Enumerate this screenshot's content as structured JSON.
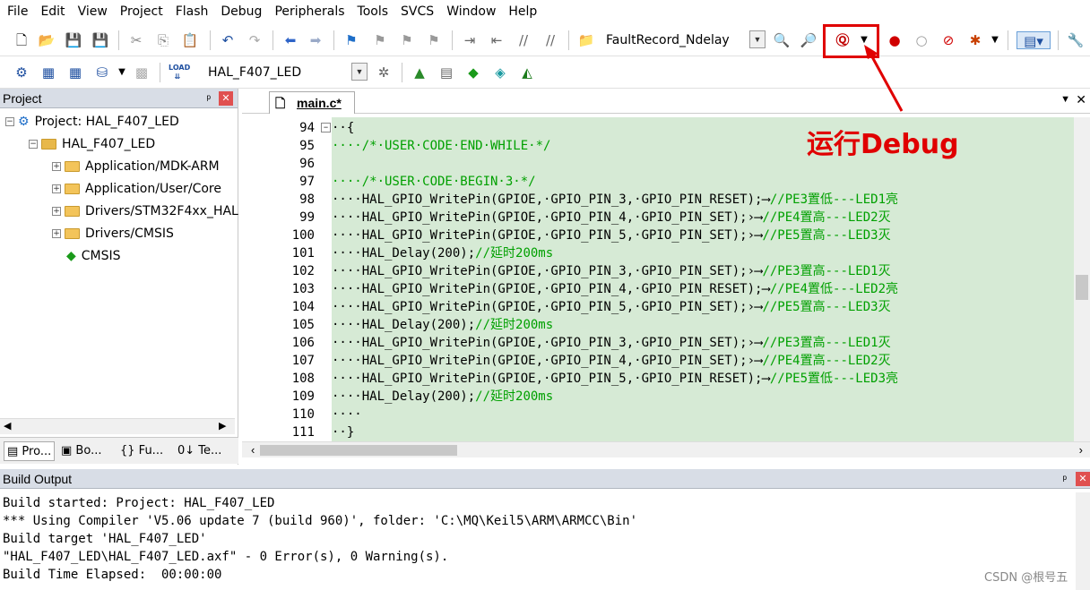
{
  "menu": [
    "File",
    "Edit",
    "View",
    "Project",
    "Flash",
    "Debug",
    "Peripherals",
    "Tools",
    "SVCS",
    "Window",
    "Help"
  ],
  "toolbar1": {
    "search_combo": "FaultRecord_Ndelay",
    "icons": [
      "new-file-icon",
      "open-folder-icon",
      "save-icon",
      "save-all-icon",
      "cut-icon",
      "copy-icon",
      "paste-icon",
      "undo-icon",
      "redo-icon",
      "nav-back-icon",
      "nav-forward-icon",
      "bookmark-icon",
      "prev-bookmark-icon",
      "next-bookmark-icon",
      "clear-bookmarks-icon",
      "indent-icon",
      "unindent-icon",
      "comment-icon",
      "uncomment-icon",
      "find-in-files-icon",
      "find-icon",
      "incremental-find-icon",
      "debug-start-icon",
      "breakpoint-icon",
      "disable-breakpoint-icon",
      "kill-breakpoints-icon",
      "breakpoints-menu-icon",
      "window-layout-icon",
      "configure-icon"
    ]
  },
  "toolbar2": {
    "target_combo": "HAL_F407_LED",
    "load_label": "LOAD"
  },
  "project_panel": {
    "title": "Project",
    "pin": "ᵖ",
    "close": "✕",
    "tree": [
      {
        "label": "Project: HAL_F407_LED",
        "level": 0,
        "type": "project",
        "expander": "⊟"
      },
      {
        "label": "HAL_F407_LED",
        "level": 1,
        "type": "target",
        "expander": "⊟"
      },
      {
        "label": "Application/MDK-ARM",
        "level": 2,
        "type": "folder",
        "expander": "+"
      },
      {
        "label": "Application/User/Core",
        "level": 2,
        "type": "folder",
        "expander": "+"
      },
      {
        "label": "Drivers/STM32F4xx_HAL",
        "level": 2,
        "type": "folder",
        "expander": "+"
      },
      {
        "label": "Drivers/CMSIS",
        "level": 2,
        "type": "folder",
        "expander": "+"
      },
      {
        "label": "CMSIS",
        "level": 2,
        "type": "component",
        "expander": ""
      }
    ],
    "bottom_tabs": [
      "Pro...",
      "Bo...",
      "{} Fu...",
      "0↓ Te..."
    ]
  },
  "editor": {
    "tab": "main.c*",
    "lines": [
      {
        "num": "94",
        "text": "··{",
        "fold": "⊟"
      },
      {
        "num": "95",
        "text": "····/*·USER·CODE·END·WHILE·*/",
        "comment": true
      },
      {
        "num": "96",
        "text": ""
      },
      {
        "num": "97",
        "text": "····/*·USER·CODE·BEGIN·3·*/",
        "comment": true
      },
      {
        "num": "98",
        "code": "····HAL_GPIO_WritePin(GPIOE,·GPIO_PIN_3,·GPIO_PIN_RESET);⟶",
        "cmt": "//PE3置低---LED1亮"
      },
      {
        "num": "99",
        "code": "····HAL_GPIO_WritePin(GPIOE,·GPIO_PIN_4,·GPIO_PIN_SET);›⟶",
        "cmt": "//PE4置高---LED2灭"
      },
      {
        "num": "100",
        "code": "····HAL_GPIO_WritePin(GPIOE,·GPIO_PIN_5,·GPIO_PIN_SET);›⟶",
        "cmt": "//PE5置高---LED3灭"
      },
      {
        "num": "101",
        "code": "····HAL_Delay(200);",
        "cmt": "//延时200ms"
      },
      {
        "num": "102",
        "code": "····HAL_GPIO_WritePin(GPIOE,·GPIO_PIN_3,·GPIO_PIN_SET);›⟶",
        "cmt": "//PE3置高---LED1灭"
      },
      {
        "num": "103",
        "code": "····HAL_GPIO_WritePin(GPIOE,·GPIO_PIN_4,·GPIO_PIN_RESET);⟶",
        "cmt": "//PE4置低---LED2亮"
      },
      {
        "num": "104",
        "code": "····HAL_GPIO_WritePin(GPIOE,·GPIO_PIN_5,·GPIO_PIN_SET);›⟶",
        "cmt": "//PE5置高---LED3灭"
      },
      {
        "num": "105",
        "code": "····HAL_Delay(200);",
        "cmt": "//延时200ms"
      },
      {
        "num": "106",
        "code": "····HAL_GPIO_WritePin(GPIOE,·GPIO_PIN_3,·GPIO_PIN_SET);›⟶",
        "cmt": "//PE3置高---LED1灭"
      },
      {
        "num": "107",
        "code": "····HAL_GPIO_WritePin(GPIOE,·GPIO_PIN_4,·GPIO_PIN_SET);›⟶",
        "cmt": "//PE4置高---LED2灭"
      },
      {
        "num": "108",
        "code": "····HAL_GPIO_WritePin(GPIOE,·GPIO_PIN_5,·GPIO_PIN_RESET);⟶",
        "cmt": "//PE5置低---LED3亮"
      },
      {
        "num": "109",
        "code": "····HAL_Delay(200);",
        "cmt": "//延时200ms"
      },
      {
        "num": "110",
        "text": "····"
      },
      {
        "num": "111",
        "text": "··}"
      }
    ]
  },
  "build_output": {
    "title": "Build Output",
    "lines": [
      "Build started: Project: HAL_F407_LED",
      "*** Using Compiler 'V5.06 update 7 (build 960)', folder: 'C:\\MQ\\Keil5\\ARM\\ARMCC\\Bin'",
      "Build target 'HAL_F407_LED'",
      "\"HAL_F407_LED\\HAL_F407_LED.axf\" - 0 Error(s), 0 Warning(s).",
      "Build Time Elapsed:  00:00:00"
    ]
  },
  "annotation": {
    "text": "运行Debug",
    "color": "#e00000"
  },
  "watermark": "CSDN @根号五",
  "colors": {
    "code_bg": "#d6ead5",
    "comment": "#00a000",
    "panel_header": "#d8dde6",
    "annotation": "#e00000"
  }
}
